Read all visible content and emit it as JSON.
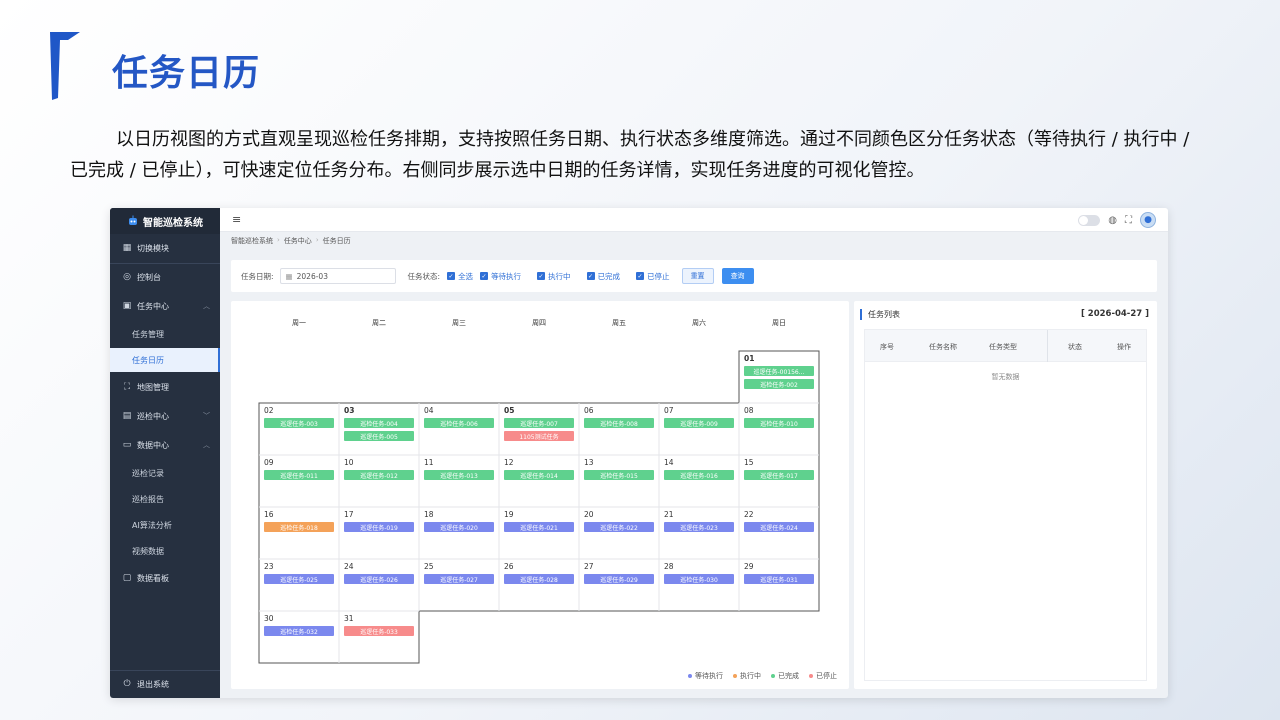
{
  "slide": {
    "title": "任务日历",
    "intro": "以日历视图的方式直观呈现巡检任务排期，支持按照任务日期、执行状态多维度筛选。通过不同颜色区分任务状态（等待执行 / 执行中 / 已完成 / 已停止），可快速定位任务分布。右侧同步展示选中日期的任务详情，实现任务进度的可视化管控。"
  },
  "colors": {
    "pending": "#7b88ee",
    "running": "#f4a259",
    "done": "#5fd18e",
    "stopped": "#f78b8b",
    "accent": "#2f6fd6"
  },
  "sidebar": {
    "logo_icon": "robot-icon",
    "app_name": "智能巡检系统",
    "switch_module": "切换模块",
    "console": "控制台",
    "task_center": "任务中心",
    "task_manage": "任务管理",
    "task_calendar": "任务日历",
    "map_manage": "地图管理",
    "inspection_center": "巡检中心",
    "data_center": "数据中心",
    "inspection_record": "巡检记录",
    "inspection_report": "巡检报告",
    "ai_analysis": "AI算法分析",
    "video_data": "视频数据",
    "dashboard": "数据看板",
    "logout": "退出系统"
  },
  "topbar": {
    "menu_icon": "hamburger-icon",
    "theme_toggle_icon": "toggle-icon",
    "language_icon": "globe-icon",
    "fullscreen_icon": "fullscreen-icon",
    "avatar_icon": "user-avatar-icon"
  },
  "breadcrumb": [
    "智能巡检系统",
    "任务中心",
    "任务日历"
  ],
  "filter": {
    "date_label": "任务日期:",
    "date_value": "2026-03",
    "status_label": "任务状态:",
    "options": [
      "全选",
      "等待执行",
      "执行中",
      "已完成",
      "已停止"
    ],
    "reset": "重置",
    "query": "查询"
  },
  "calendar": {
    "weekdays": [
      "周一",
      "周二",
      "周三",
      "周四",
      "周五",
      "周六",
      "周日"
    ],
    "days": [
      {
        "day": "01",
        "bold": true,
        "tasks": [
          {
            "name": "巡逻任务-00156...",
            "status": "done"
          },
          {
            "name": "巡检任务-002",
            "status": "done"
          }
        ]
      },
      {
        "day": "02",
        "tasks": [
          {
            "name": "巡逻任务-003",
            "status": "done"
          }
        ]
      },
      {
        "day": "03",
        "bold": true,
        "tasks": [
          {
            "name": "巡检任务-004",
            "status": "done"
          },
          {
            "name": "巡逻任务-005",
            "status": "done"
          }
        ]
      },
      {
        "day": "04",
        "tasks": [
          {
            "name": "巡检任务-006",
            "status": "done"
          }
        ]
      },
      {
        "day": "05",
        "bold": true,
        "tasks": [
          {
            "name": "巡逻任务-007",
            "status": "done"
          },
          {
            "name": "1105测试任务",
            "status": "stopped"
          }
        ]
      },
      {
        "day": "06",
        "tasks": [
          {
            "name": "巡检任务-008",
            "status": "done"
          }
        ]
      },
      {
        "day": "07",
        "tasks": [
          {
            "name": "巡逻任务-009",
            "status": "done"
          }
        ]
      },
      {
        "day": "08",
        "tasks": [
          {
            "name": "巡检任务-010",
            "status": "done"
          }
        ]
      },
      {
        "day": "09",
        "tasks": [
          {
            "name": "巡逻任务-011",
            "status": "done"
          }
        ]
      },
      {
        "day": "10",
        "tasks": [
          {
            "name": "巡逻任务-012",
            "status": "done"
          }
        ]
      },
      {
        "day": "11",
        "tasks": [
          {
            "name": "巡逻任务-013",
            "status": "done"
          }
        ]
      },
      {
        "day": "12",
        "tasks": [
          {
            "name": "巡逻任务-014",
            "status": "done"
          }
        ]
      },
      {
        "day": "13",
        "tasks": [
          {
            "name": "巡检任务-015",
            "status": "done"
          }
        ]
      },
      {
        "day": "14",
        "tasks": [
          {
            "name": "巡逻任务-016",
            "status": "done"
          }
        ]
      },
      {
        "day": "15",
        "tasks": [
          {
            "name": "巡逻任务-017",
            "status": "done"
          }
        ]
      },
      {
        "day": "16",
        "tasks": [
          {
            "name": "巡检任务-018",
            "status": "running"
          }
        ]
      },
      {
        "day": "17",
        "tasks": [
          {
            "name": "巡逻任务-019",
            "status": "pending"
          }
        ]
      },
      {
        "day": "18",
        "tasks": [
          {
            "name": "巡逻任务-020",
            "status": "pending"
          }
        ]
      },
      {
        "day": "19",
        "tasks": [
          {
            "name": "巡逻任务-021",
            "status": "pending"
          }
        ]
      },
      {
        "day": "20",
        "tasks": [
          {
            "name": "巡逻任务-022",
            "status": "pending"
          }
        ]
      },
      {
        "day": "21",
        "tasks": [
          {
            "name": "巡逻任务-023",
            "status": "pending"
          }
        ]
      },
      {
        "day": "22",
        "tasks": [
          {
            "name": "巡逻任务-024",
            "status": "pending"
          }
        ]
      },
      {
        "day": "23",
        "tasks": [
          {
            "name": "巡逻任务-025",
            "status": "pending"
          }
        ]
      },
      {
        "day": "24",
        "tasks": [
          {
            "name": "巡逻任务-026",
            "status": "pending"
          }
        ]
      },
      {
        "day": "25",
        "tasks": [
          {
            "name": "巡逻任务-027",
            "status": "pending"
          }
        ]
      },
      {
        "day": "26",
        "tasks": [
          {
            "name": "巡逻任务-028",
            "status": "pending"
          }
        ]
      },
      {
        "day": "27",
        "tasks": [
          {
            "name": "巡逻任务-029",
            "status": "pending"
          }
        ]
      },
      {
        "day": "28",
        "tasks": [
          {
            "name": "巡检任务-030",
            "status": "pending"
          }
        ]
      },
      {
        "day": "29",
        "tasks": [
          {
            "name": "巡逻任务-031",
            "status": "pending"
          }
        ]
      },
      {
        "day": "30",
        "tasks": [
          {
            "name": "巡检任务-032",
            "status": "pending"
          }
        ]
      },
      {
        "day": "31",
        "tasks": [
          {
            "name": "巡逻任务-033",
            "status": "stopped"
          }
        ]
      }
    ],
    "legend": [
      {
        "label": "等待执行",
        "status": "pending"
      },
      {
        "label": "执行中",
        "status": "running"
      },
      {
        "label": "已完成",
        "status": "done"
      },
      {
        "label": "已停止",
        "status": "stopped"
      }
    ]
  },
  "task_list": {
    "title": "任务列表",
    "date": "[ 2026-04-27 ]",
    "columns": [
      "序号",
      "任务名称",
      "任务类型",
      "状态",
      "操作"
    ],
    "empty": "暂无数据"
  }
}
